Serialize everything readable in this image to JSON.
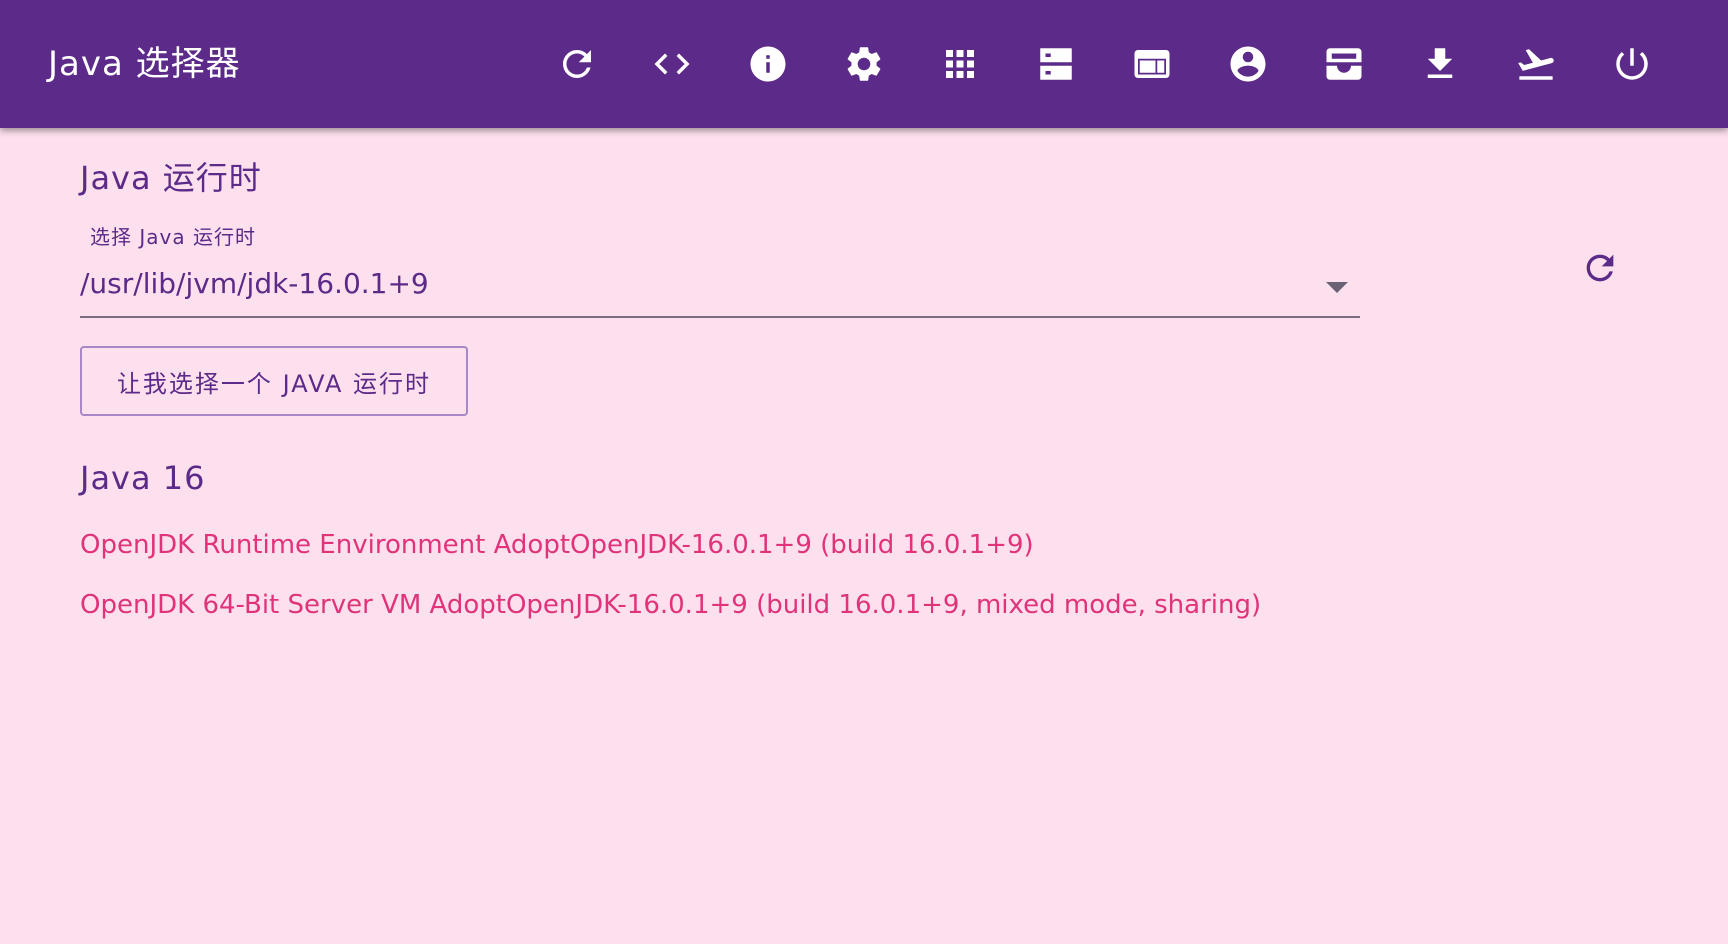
{
  "app": {
    "title": "Java 选择器",
    "colors": {
      "appbar": "#5c2a88",
      "background": "#fde0ee",
      "primary": "#5c2a88",
      "accent": "#e0337a"
    }
  },
  "toolbar": {
    "icons": [
      "refresh-icon",
      "code-icon",
      "info-icon",
      "settings-icon",
      "apps-grid-icon",
      "storage-icon",
      "web-asset-icon",
      "account-circle-icon",
      "inbox-icon",
      "download-icon",
      "flight-takeoff-icon",
      "power-icon"
    ]
  },
  "runtime": {
    "section_title": "Java 运行时",
    "select_label": "选择 Java 运行时",
    "selected_value": "/usr/lib/jvm/jdk-16.0.1+9",
    "choose_button_label": "让我选择一个 JAVA 运行时"
  },
  "version": {
    "title": "Java 16",
    "lines": [
      "OpenJDK Runtime Environment AdoptOpenJDK-16.0.1+9 (build 16.0.1+9)",
      "OpenJDK 64-Bit Server VM AdoptOpenJDK-16.0.1+9 (build 16.0.1+9, mixed mode, sharing)"
    ]
  }
}
